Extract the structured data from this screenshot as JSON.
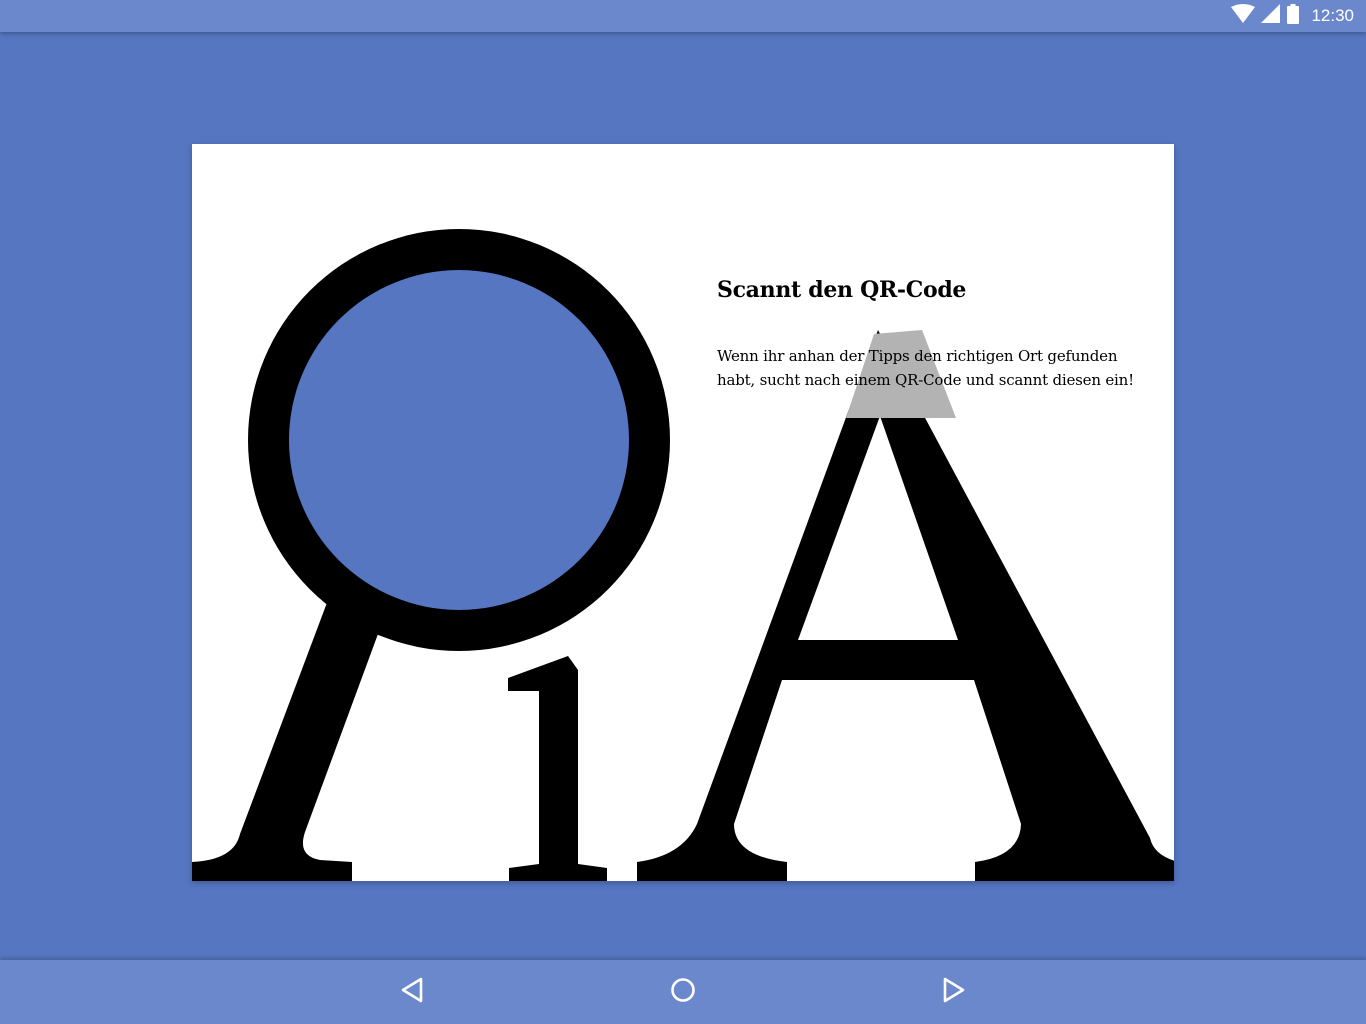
{
  "status_bar": {
    "time": "12:30",
    "icons": [
      "wifi-icon",
      "cell-signal-icon",
      "battery-icon"
    ]
  },
  "card": {
    "title": "Scannt den QR-Code",
    "text": "Wenn ihr anhan der Tipps den richtigen Ort gefunden habt, sucht nach einem QR-Code und scannt diesen ein!",
    "illustration": "magnifier-1A-letters"
  },
  "nav_bar": {
    "buttons": [
      "back-icon",
      "home-icon",
      "forward-icon"
    ]
  },
  "colors": {
    "background": "#5676c2",
    "bars": "#6c88cc",
    "card": "#ffffff",
    "ink": "#000000",
    "highlight": "#b3b3b3"
  }
}
